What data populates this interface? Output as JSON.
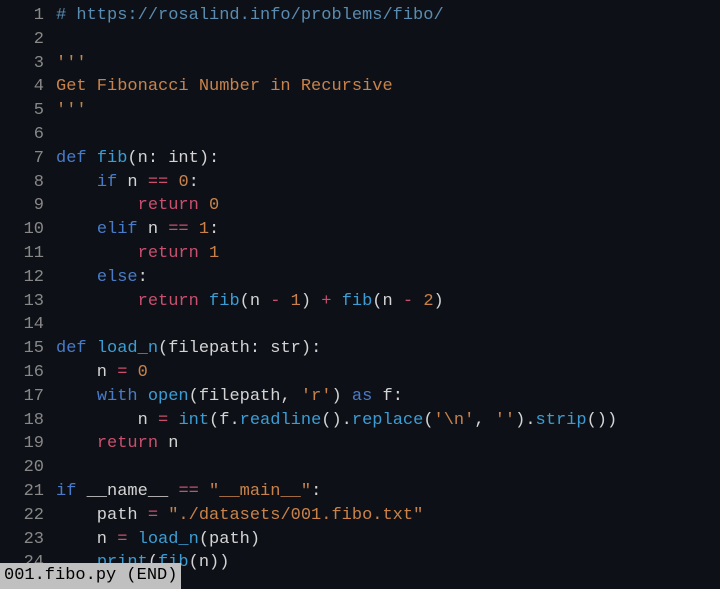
{
  "status": "001.fibo.py (END)",
  "lines": [
    {
      "no": 1,
      "tokens": [
        [
          "comment",
          "# https://rosalind.info/problems/fibo/"
        ]
      ]
    },
    {
      "no": 2,
      "tokens": []
    },
    {
      "no": 3,
      "tokens": [
        [
          "string",
          "'''"
        ]
      ]
    },
    {
      "no": 4,
      "tokens": [
        [
          "string",
          "Get Fibonacci Number in Recursive"
        ]
      ]
    },
    {
      "no": 5,
      "tokens": [
        [
          "string",
          "'''"
        ]
      ]
    },
    {
      "no": 6,
      "tokens": []
    },
    {
      "no": 7,
      "tokens": [
        [
          "keyword-blue",
          "def "
        ],
        [
          "func",
          "fib"
        ],
        [
          "punct",
          "("
        ],
        [
          "param",
          "n"
        ],
        [
          "punct",
          ": "
        ],
        [
          "type",
          "int"
        ],
        [
          "punct",
          "):"
        ]
      ]
    },
    {
      "no": 8,
      "tokens": [
        [
          "ident",
          "    "
        ],
        [
          "keyword-blue",
          "if"
        ],
        [
          "ident",
          " n "
        ],
        [
          "op",
          "=="
        ],
        [
          "ident",
          " "
        ],
        [
          "number",
          "0"
        ],
        [
          "punct",
          ":"
        ]
      ]
    },
    {
      "no": 9,
      "tokens": [
        [
          "ident",
          "        "
        ],
        [
          "keyword",
          "return"
        ],
        [
          "ident",
          " "
        ],
        [
          "number",
          "0"
        ]
      ]
    },
    {
      "no": 10,
      "tokens": [
        [
          "ident",
          "    "
        ],
        [
          "keyword-blue",
          "elif"
        ],
        [
          "ident",
          " n "
        ],
        [
          "op",
          "=="
        ],
        [
          "ident",
          " "
        ],
        [
          "number",
          "1"
        ],
        [
          "punct",
          ":"
        ]
      ]
    },
    {
      "no": 11,
      "tokens": [
        [
          "ident",
          "        "
        ],
        [
          "keyword",
          "return"
        ],
        [
          "ident",
          " "
        ],
        [
          "number",
          "1"
        ]
      ]
    },
    {
      "no": 12,
      "tokens": [
        [
          "ident",
          "    "
        ],
        [
          "keyword-blue",
          "else"
        ],
        [
          "punct",
          ":"
        ]
      ]
    },
    {
      "no": 13,
      "tokens": [
        [
          "ident",
          "        "
        ],
        [
          "keyword",
          "return"
        ],
        [
          "ident",
          " "
        ],
        [
          "func",
          "fib"
        ],
        [
          "punct",
          "("
        ],
        [
          "ident",
          "n "
        ],
        [
          "op",
          "-"
        ],
        [
          "ident",
          " "
        ],
        [
          "number",
          "1"
        ],
        [
          "punct",
          ") "
        ],
        [
          "op",
          "+"
        ],
        [
          "ident",
          " "
        ],
        [
          "func",
          "fib"
        ],
        [
          "punct",
          "("
        ],
        [
          "ident",
          "n "
        ],
        [
          "op",
          "-"
        ],
        [
          "ident",
          " "
        ],
        [
          "number",
          "2"
        ],
        [
          "punct",
          ")"
        ]
      ]
    },
    {
      "no": 14,
      "tokens": []
    },
    {
      "no": 15,
      "tokens": [
        [
          "keyword-blue",
          "def "
        ],
        [
          "func",
          "load_n"
        ],
        [
          "punct",
          "("
        ],
        [
          "param",
          "filepath"
        ],
        [
          "punct",
          ": "
        ],
        [
          "type",
          "str"
        ],
        [
          "punct",
          "):"
        ]
      ]
    },
    {
      "no": 16,
      "tokens": [
        [
          "ident",
          "    n "
        ],
        [
          "op",
          "="
        ],
        [
          "ident",
          " "
        ],
        [
          "number",
          "0"
        ]
      ]
    },
    {
      "no": 17,
      "tokens": [
        [
          "ident",
          "    "
        ],
        [
          "keyword-blue",
          "with"
        ],
        [
          "ident",
          " "
        ],
        [
          "builtin",
          "open"
        ],
        [
          "punct",
          "("
        ],
        [
          "ident",
          "filepath"
        ],
        [
          "punct",
          ", "
        ],
        [
          "string",
          "'r'"
        ],
        [
          "punct",
          ") "
        ],
        [
          "keyword-blue",
          "as"
        ],
        [
          "ident",
          " f"
        ],
        [
          "punct",
          ":"
        ]
      ]
    },
    {
      "no": 18,
      "tokens": [
        [
          "ident",
          "        n "
        ],
        [
          "op",
          "="
        ],
        [
          "ident",
          " "
        ],
        [
          "builtin",
          "int"
        ],
        [
          "punct",
          "("
        ],
        [
          "ident",
          "f"
        ],
        [
          "punct",
          "."
        ],
        [
          "func",
          "readline"
        ],
        [
          "punct",
          "()."
        ],
        [
          "func",
          "replace"
        ],
        [
          "punct",
          "("
        ],
        [
          "string",
          "'\\n'"
        ],
        [
          "punct",
          ", "
        ],
        [
          "string",
          "''"
        ],
        [
          "punct",
          ")."
        ],
        [
          "func",
          "strip"
        ],
        [
          "punct",
          "())"
        ]
      ]
    },
    {
      "no": 19,
      "tokens": [
        [
          "ident",
          "    "
        ],
        [
          "keyword",
          "return"
        ],
        [
          "ident",
          " n"
        ]
      ]
    },
    {
      "no": 20,
      "tokens": []
    },
    {
      "no": 21,
      "tokens": [
        [
          "keyword-blue",
          "if"
        ],
        [
          "ident",
          " __name__ "
        ],
        [
          "op",
          "=="
        ],
        [
          "ident",
          " "
        ],
        [
          "string",
          "\"__main__\""
        ],
        [
          "punct",
          ":"
        ]
      ]
    },
    {
      "no": 22,
      "tokens": [
        [
          "ident",
          "    path "
        ],
        [
          "op",
          "="
        ],
        [
          "ident",
          " "
        ],
        [
          "string",
          "\"./datasets/001.fibo.txt\""
        ]
      ]
    },
    {
      "no": 23,
      "tokens": [
        [
          "ident",
          "    n "
        ],
        [
          "op",
          "="
        ],
        [
          "ident",
          " "
        ],
        [
          "func",
          "load_n"
        ],
        [
          "punct",
          "("
        ],
        [
          "ident",
          "path"
        ],
        [
          "punct",
          ")"
        ]
      ]
    },
    {
      "no": 24,
      "tokens": [
        [
          "ident",
          "    "
        ],
        [
          "builtin",
          "print"
        ],
        [
          "punct",
          "("
        ],
        [
          "func",
          "fib"
        ],
        [
          "punct",
          "("
        ],
        [
          "ident",
          "n"
        ],
        [
          "punct",
          "))"
        ]
      ]
    }
  ]
}
